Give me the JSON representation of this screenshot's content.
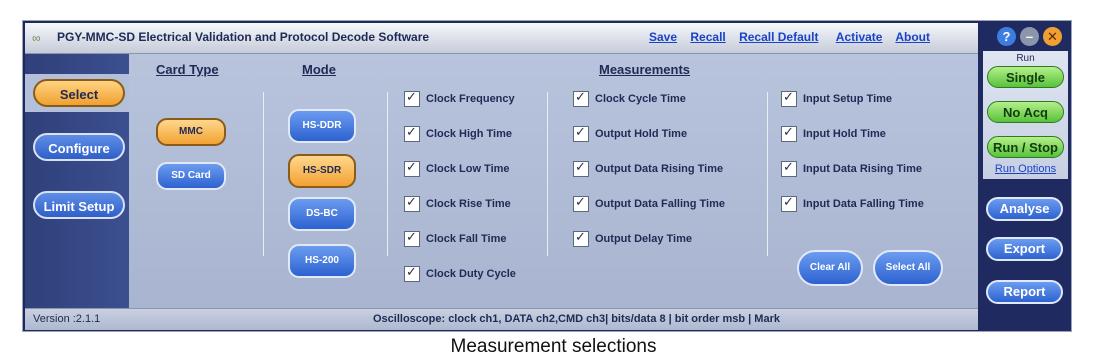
{
  "window": {
    "title": "PGY-MMC-SD Electrical Validation and Protocol Decode Software",
    "links": [
      "Save",
      "Recall",
      "Recall Default",
      "Activate",
      "About"
    ]
  },
  "nav": {
    "items": [
      "Select",
      "Configure",
      "Limit Setup"
    ],
    "selected": "Select"
  },
  "card_type": {
    "heading": "Card Type",
    "options": [
      "MMC",
      "SD Card"
    ],
    "selected": "MMC"
  },
  "mode": {
    "heading": "Mode",
    "options": [
      "HS-DDR",
      "HS-SDR",
      "DS-BC",
      "HS-200"
    ],
    "selected": "HS-SDR"
  },
  "measurements": {
    "heading": "Measurements",
    "columns": [
      [
        "Clock Frequency",
        "Clock High Time",
        "Clock Low Time",
        "Clock Rise Time",
        "Clock Fall Time",
        "Clock Duty Cycle"
      ],
      [
        "Clock Cycle Time",
        "Output Hold Time",
        "Output Data Rising Time",
        "Output Data Falling Time",
        "Output Delay Time"
      ],
      [
        "Input Setup Time",
        "Input Hold Time",
        "Input Data Rising Time",
        "Input Data Falling Time"
      ]
    ],
    "checkmark": "✓",
    "clear_all": "Clear All",
    "select_all": "Select All"
  },
  "status": {
    "version": "Version :2.1.1",
    "oscilloscope": "Oscilloscope: clock ch1, DATA ch2,CMD ch3| bits/data 8 | bit order msb | Mark"
  },
  "right_panel": {
    "help": "?",
    "minimize": "–",
    "close": "✕",
    "run_label": "Run",
    "single": "Single",
    "no_acq": "No Acq",
    "run_stop": "Run / Stop",
    "run_options": "Run Options",
    "analyse": "Analyse",
    "export": "Export",
    "report": "Report"
  },
  "caption": "Measurement selections",
  "colors": {
    "frame": "#1e2a5e",
    "panel": "#b2bdd8",
    "selected_orange": "#f2a233",
    "button_blue": "#2d62d0",
    "run_green": "#57c23a",
    "link_blue": "#1a44c8"
  }
}
